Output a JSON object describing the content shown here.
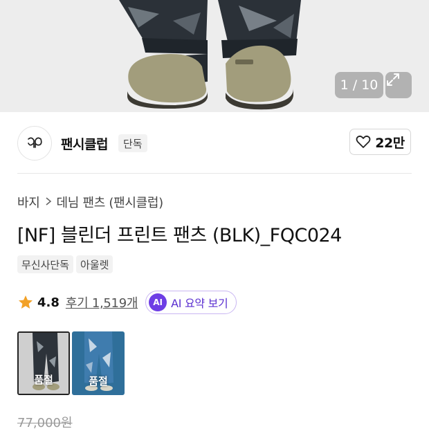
{
  "gallery": {
    "counter": "1 / 10",
    "expand_icon": "expand-arrows-icon"
  },
  "brand": {
    "name": "팬시클럽",
    "tag": "단독",
    "logo_icon": "fancyclub-logo-icon",
    "like_count": "22만",
    "like_icon": "heart-outline-icon"
  },
  "breadcrumb": {
    "items": [
      "바지",
      "데님 팬츠 (팬시클럽)"
    ],
    "separator_icon": "chevron-right-icon"
  },
  "product": {
    "title": "[NF] 블린더 프린트 팬츠 (BLK)_FQC024",
    "tags": [
      "무신사단독",
      "아울렛"
    ],
    "rating": "4.8",
    "star_color": "#f2a127",
    "review_text": "후기 1,519개",
    "ai_badge": "AI",
    "ai_label": "AI 요약 보기",
    "ai_color": "#6e3ee5"
  },
  "options": [
    {
      "label": "품절",
      "selected": true
    },
    {
      "label": "품절",
      "selected": false
    }
  ],
  "price": {
    "original": "77,000원"
  }
}
